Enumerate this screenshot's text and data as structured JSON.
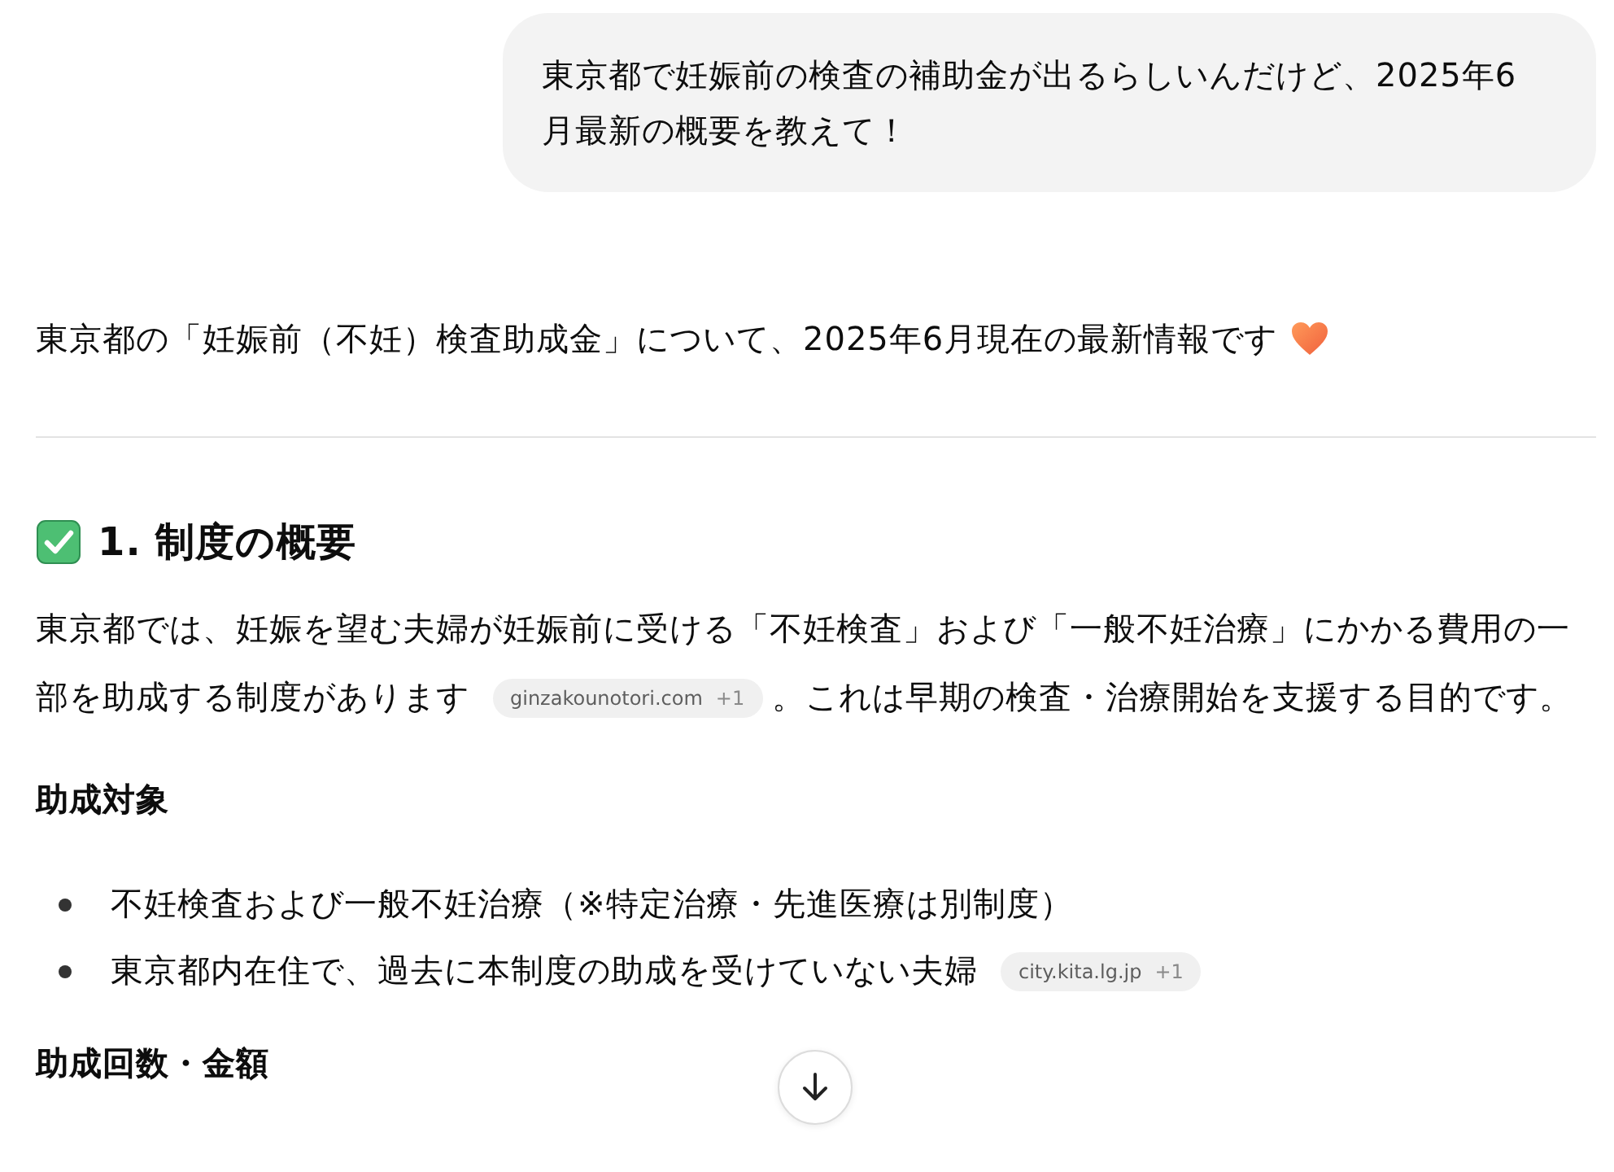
{
  "user_message": {
    "text": "東京都で妊娠前の検査の補助金が出るらしいんだけど、2025年6月最新の概要を教えて！"
  },
  "response": {
    "intro": "東京都の「妊娠前（不妊）検査助成金」について、2025年6月現在の最新情報です",
    "sections": [
      {
        "heading": "1. 制度の概要",
        "paragraph": [
          {
            "kind": "text",
            "text": "東京都では、妊娠を望む夫婦が妊娠前に受ける「不妊検査」および「一般不妊治療」にかかる費用の一部を助成する制度があります"
          },
          {
            "kind": "citation",
            "text": "ginzakounotori.com",
            "more": "+1"
          },
          {
            "kind": "text",
            "text": "。これは早期の検査・治療開始を支援する目的です。"
          }
        ],
        "subsections": [
          {
            "heading": "助成対象",
            "bullets": [
              [
                {
                  "kind": "text",
                  "text": "不妊検査および一般不妊治療（※特定治療・先進医療は別制度）"
                }
              ],
              [
                {
                  "kind": "text",
                  "text": "東京都内在住で、過去に本制度の助成を受けていない夫婦"
                },
                {
                  "kind": "citation",
                  "text": "city.kita.lg.jp",
                  "more": "+1"
                }
              ]
            ]
          },
          {
            "heading": "助成回数・金額"
          }
        ]
      }
    ]
  }
}
